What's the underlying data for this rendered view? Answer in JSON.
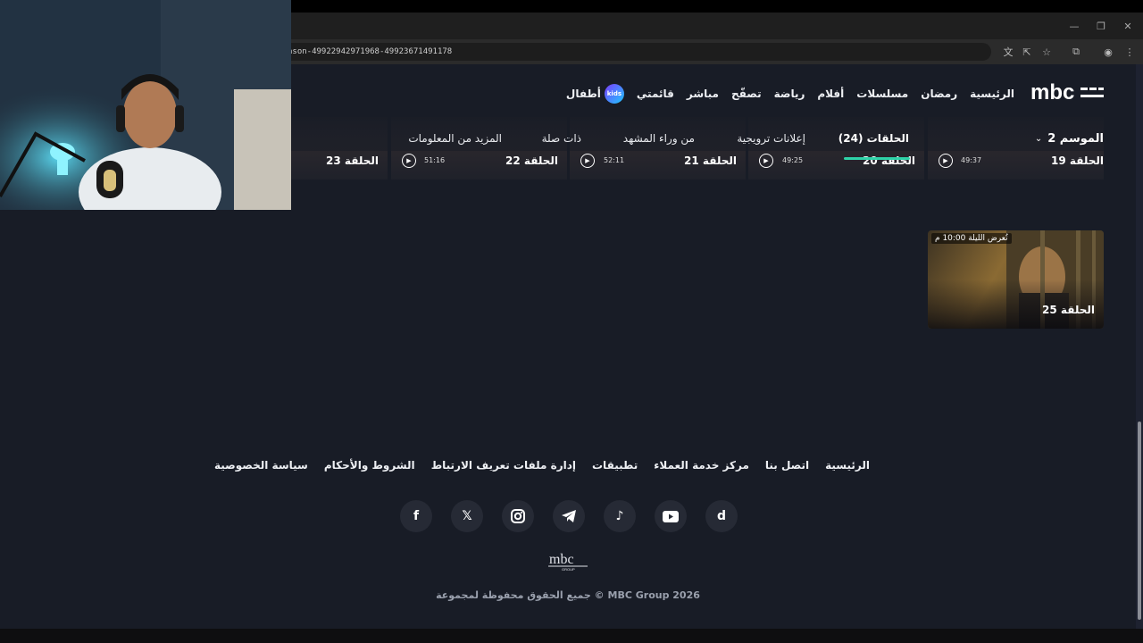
{
  "browser": {
    "url": "ason-49922942971968-49923671491178"
  },
  "header": {
    "logo_alt": "mbc shahid",
    "nav": [
      "الرئيسية",
      "رمضان",
      "مسلسلات",
      "أفلام",
      "رياضة",
      "تصفّح",
      "مباشر",
      "قائمتي"
    ],
    "kids_label": "أطفال",
    "kids_badge": "kids"
  },
  "season": {
    "label": "الموسم 2",
    "tabs": [
      "الحلقات (24)",
      "إعلانات ترويجية",
      "من وراء المشهد",
      "ذات صلة",
      "المزيد من المعلومات"
    ],
    "active_tab": 0
  },
  "episodes": [
    {
      "title": "الحلقة 19",
      "duration": "49:37"
    },
    {
      "title": "الحلقة 20",
      "duration": "49:25"
    },
    {
      "title": "الحلقة 21",
      "duration": "52:11"
    },
    {
      "title": "الحلقة 22",
      "duration": "51:16"
    },
    {
      "title": "الحلقة 23",
      "duration": ""
    }
  ],
  "upcoming": {
    "air_time": "تُعرض الليلة 10:00 م",
    "title": "الحلقة 25"
  },
  "footer": {
    "links": [
      "الرئيسية",
      "اتصل بنا",
      "مركز خدمة العملاء",
      "تطبيقات",
      "إدارة ملفات تعريف الارتباط",
      "الشروط والأحكام",
      "سياسة الخصوصية"
    ],
    "social_icons": [
      "shahid-icon",
      "youtube-icon",
      "tiktok-icon",
      "telegram-icon",
      "instagram-icon",
      "x-icon",
      "facebook-icon"
    ],
    "copyright": "جميع الحقوق محفوظة لمجموعة © MBC Group 2026"
  },
  "colors": {
    "page_bg": "#181c26",
    "accent": "#2fd3a8"
  }
}
